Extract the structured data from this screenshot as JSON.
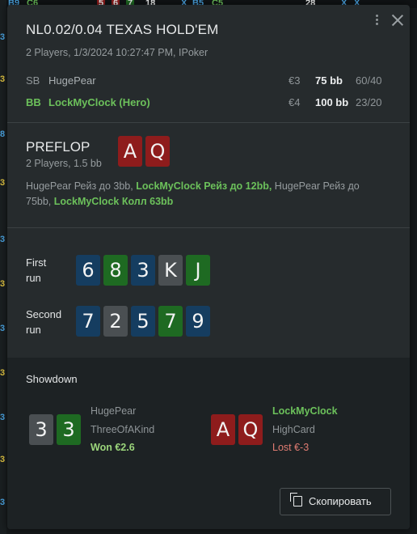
{
  "background": {
    "top_strip": [
      "B9",
      "C6",
      "5",
      "6",
      "7",
      "18",
      "X",
      "B5",
      "C5",
      "28",
      "X",
      "X"
    ],
    "left_strip": [
      "3",
      "3",
      "8",
      "3",
      "3",
      "3",
      "3",
      "3",
      "3",
      "3",
      "3"
    ]
  },
  "header": {
    "title": "NL0.02/0.04 TEXAS HOLD'EM",
    "subtitle": "2 Players, 1/3/2024 10:27:47 PM, IPoker",
    "players": [
      {
        "position": "SB",
        "name": "HugePear",
        "stack": "€3",
        "bb": "75 bb",
        "stat": "60/40"
      },
      {
        "position": "BB",
        "name": "LockMyClock (Hero)",
        "stack": "€4",
        "bb": "100 bb",
        "stat": "23/20"
      }
    ]
  },
  "preflop": {
    "title": "PREFLOP",
    "subtitle": "2 Players, 1.5 bb",
    "hole_cards": [
      "A",
      "Q"
    ],
    "actions": [
      {
        "text": "HugePear Рейз до 3bb, ",
        "hero": false
      },
      {
        "text": "LockMyClock Рейз до 12bb,",
        "hero": true
      },
      {
        "text": " HugePear Рейз до 75bb, ",
        "hero": false
      },
      {
        "text": "LockMyClock Колл 63bb",
        "hero": true
      }
    ]
  },
  "runs": [
    {
      "label_line1": "First",
      "label_line2": "run",
      "cards": [
        "6",
        "8",
        "3",
        "K",
        "J"
      ]
    },
    {
      "label_line1": "Second",
      "label_line2": "run",
      "cards": [
        "7",
        "2",
        "5",
        "7",
        "9"
      ]
    }
  ],
  "showdown": {
    "title": "Showdown",
    "villain": {
      "cards": [
        "3",
        "3"
      ],
      "name": "HugePear",
      "hand": "ThreeOfAKind",
      "result": "Won €2.6"
    },
    "hero": {
      "cards": [
        "A",
        "Q"
      ],
      "name": "LockMyClock",
      "hand": "HighCard",
      "result": "Lost €-3"
    }
  },
  "copy_button": {
    "label": "Скопировать"
  },
  "colors": {
    "red_suit": "#8e1c1c",
    "green_suit": "#1e6a22",
    "blue_suit": "#153d60",
    "gray_suit": "#4a4f52",
    "hero": "#6cc15b",
    "won": "#9bd57b",
    "lost": "#e07c72"
  }
}
